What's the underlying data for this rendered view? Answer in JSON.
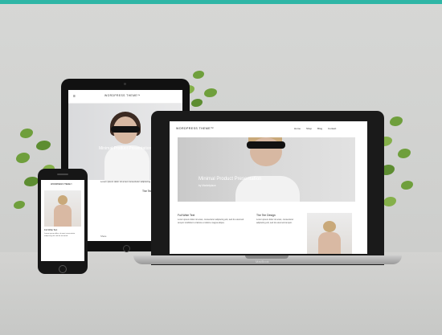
{
  "tablet": {
    "brand": "WORDPRESS THEME™",
    "menu_icon": "≡",
    "hero_title": "Minimal Product Presentation",
    "text": "Lorem ipsum dolor sit amet consectetur adipiscing elit sed do",
    "subheading": "The Tee Design",
    "footer": "Share"
  },
  "laptop": {
    "brand": "WORDPRESS THEME™",
    "nav": [
      "Home",
      "Shop",
      "Blog",
      "Contact"
    ],
    "hero_title": "Minimal Product Presentation",
    "byline": "by Marketplace",
    "section1_title": "Full Wide Text",
    "section1_body": "Lorem ipsum dolor sit amet, consectetur adipiscing elit, sed do eiusmod tempor incididunt ut labore et dolore magna aliqua.",
    "section2_title": "The Tee Design",
    "section2_body": "Lorem ipsum dolor sit amet, consectetur adipiscing elit, sed do eiusmod tempor.",
    "model_label": "MacBook"
  },
  "phone": {
    "brand": "WORDPRESS THEME™",
    "heading": "Full Wide Text",
    "text": "Lorem ipsum dolor sit amet consectetur adipiscing elit sed do eiusmod"
  },
  "colors": {
    "accent_bar": "#2fb6a6",
    "background": "#cfd0ce",
    "plant": "#6f9f3c",
    "device_frame": "#161616"
  }
}
